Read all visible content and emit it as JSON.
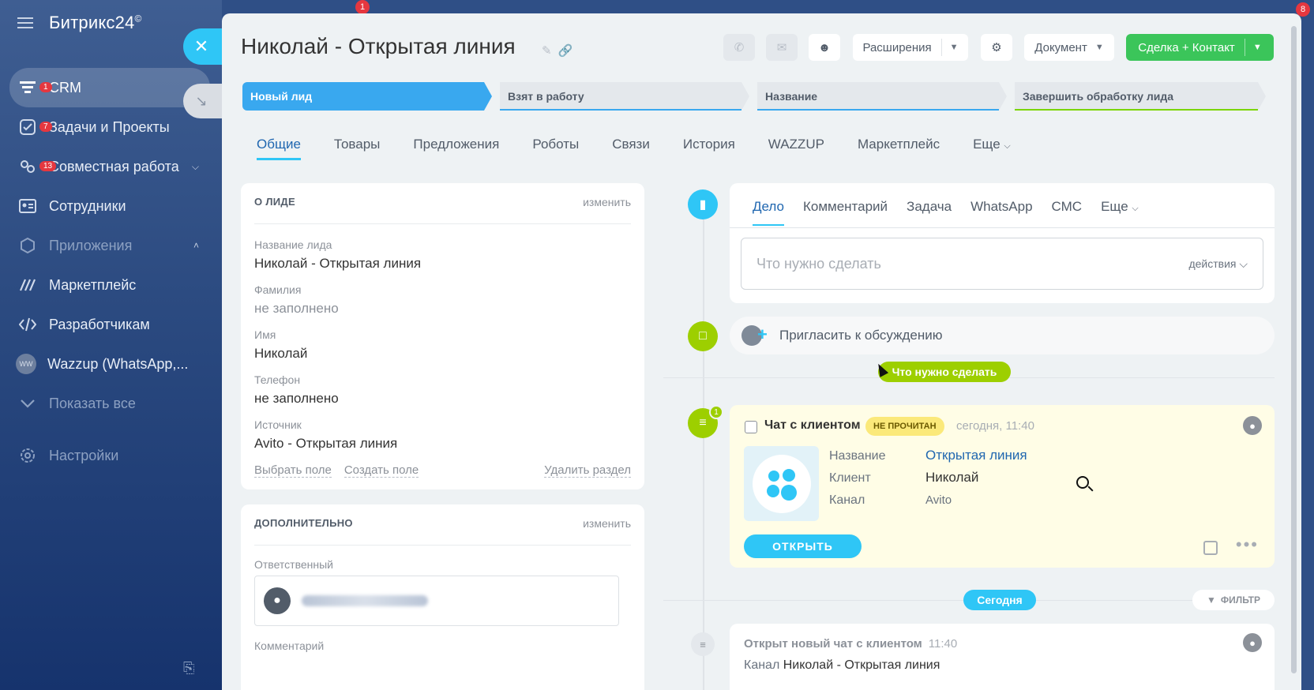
{
  "sidebar": {
    "brand": "Битрикс24",
    "brand_mark": "©",
    "items": [
      {
        "label": "CRM",
        "badge": "1",
        "icon": "filter-icon"
      },
      {
        "label": "Задачи и Проекты",
        "badge": "7",
        "icon": "task-icon"
      },
      {
        "label": "Совместная работа",
        "badge": "13",
        "icon": "collab-icon"
      },
      {
        "label": "Сотрудники",
        "icon": "employees-icon"
      },
      {
        "label": "Приложения",
        "icon": "apps-icon"
      },
      {
        "label": "Маркетплейс",
        "icon": "market-icon"
      },
      {
        "label": "Разработчикам",
        "icon": "code-icon"
      },
      {
        "label": "Wazzup (WhatsApp,...",
        "avatar": "WW"
      },
      {
        "label": "Показать все",
        "icon": "chevron-down-icon"
      },
      {
        "label": "Настройки",
        "icon": "gear-icon"
      }
    ]
  },
  "bg_badges": {
    "top": "1",
    "right": "8"
  },
  "header": {
    "title": "Николай - Открытая линия",
    "extensions": "Расширения",
    "document": "Документ",
    "deal_contact": "Сделка + Контакт"
  },
  "stages": [
    "Новый лид",
    "Взят в работу",
    "Название",
    "Завершить обработку лида"
  ],
  "stage_colors": {
    "active": "#39a8ef",
    "inactive": "#e4e8ec",
    "line_blue": "#39a8ef",
    "line_green": "#7bd500"
  },
  "tabs": [
    "Общие",
    "Товары",
    "Предложения",
    "Роботы",
    "Связи",
    "История",
    "WAZZUP",
    "Маркетплейс",
    "Еще"
  ],
  "about": {
    "title": "О ЛИДЕ",
    "edit": "изменить",
    "fields": [
      {
        "label": "Название лида",
        "value": "Николай - Открытая линия"
      },
      {
        "label": "Фамилия",
        "value": "не заполнено"
      },
      {
        "label": "Имя",
        "value": "Николай"
      },
      {
        "label": "Телефон",
        "value": "не заполнено"
      },
      {
        "label": "Источник",
        "value": "Avito - Открытая линия"
      }
    ],
    "choose_field": "Выбрать поле",
    "create_field": "Создать поле",
    "delete_section": "Удалить раздел"
  },
  "extra": {
    "title": "ДОПОЛНИТЕЛЬНО",
    "edit": "изменить",
    "responsible_label": "Ответственный",
    "comment_label": "Комментарий"
  },
  "composer": {
    "tabs": [
      "Дело",
      "Комментарий",
      "Задача",
      "WhatsApp",
      "СМС",
      "Еще"
    ],
    "placeholder": "Что нужно сделать",
    "actions": "действия"
  },
  "invite": "Пригласить к обсуждению",
  "todo_pill": "Что нужно сделать",
  "chat": {
    "badge": "1",
    "title": "Чат с клиентом",
    "unread": "НЕ ПРОЧИТАН",
    "time": "сегодня, 11:40",
    "rows": [
      {
        "key": "Название",
        "value": "Открытая линия"
      },
      {
        "key": "Клиент",
        "value": "Николай"
      },
      {
        "key": "Канал",
        "value": "Avito"
      }
    ],
    "open": "ОТКРЫТЬ"
  },
  "today": "Сегодня",
  "filter": "ФИЛЬТР",
  "history": {
    "title": "Открыт новый чат с клиентом",
    "time": "11:40",
    "channel_label": "Канал",
    "channel_value": "Николай - Открытая линия"
  },
  "colors": {
    "accent": "#2fc6f6",
    "green": "#3bc55a",
    "lime": "#9dcf00",
    "link": "#2067b0"
  }
}
